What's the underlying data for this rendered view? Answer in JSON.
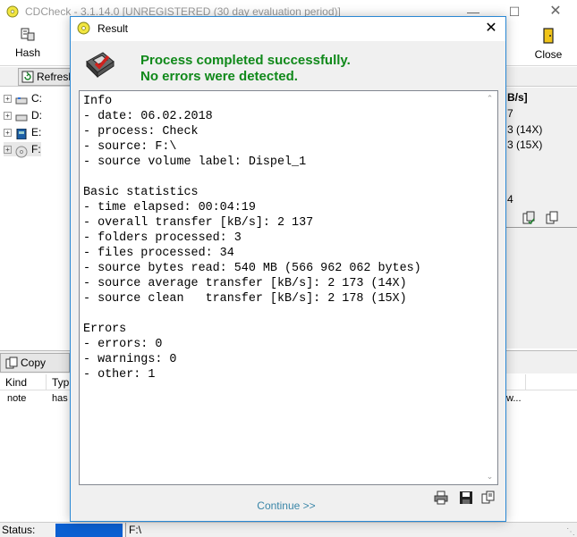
{
  "main": {
    "title": "CDCheck - 3.1.14.0 [UNREGISTERED (30 day evaluation period)]",
    "toolbar": {
      "hash_label": "Hash",
      "close_label": "Close"
    },
    "refresh_label": "Refresh",
    "drives": [
      {
        "label": "C:",
        "icon": "hard-drive-icon"
      },
      {
        "label": "D:",
        "icon": "hard-drive-icon"
      },
      {
        "label": "E:",
        "icon": "usb-drive-icon"
      },
      {
        "label": "F:",
        "icon": "cd-drive-icon"
      }
    ],
    "right_panel": {
      "header": "B/s]",
      "l1": "7",
      "l2": "3 (14X)",
      "l3": "3 (15X)",
      "l4": "4"
    },
    "copy_label": "Copy",
    "list": {
      "columns": [
        "Kind",
        "Typ"
      ],
      "rows": [
        {
          "kind": "note",
          "type": "has",
          "tail": "w..."
        }
      ]
    },
    "status": {
      "label": "Status:",
      "path": "F:\\",
      "progress": 1.0,
      "progress_color": "#0a5fd1"
    }
  },
  "dialog": {
    "title": "Result",
    "message_line1": "Process completed successfully.",
    "message_line2": "No errors were detected.",
    "message_color": "#10891a",
    "report_lines": [
      "Info",
      "- date: 06.02.2018",
      "- process: Check",
      "- source: F:\\",
      "- source volume label: Dispel_1",
      "",
      "Basic statistics",
      "- time elapsed: 00:04:19",
      "- overall transfer [kB/s]: 2 137",
      "- folders processed: 3",
      "- files processed: 34",
      "- source bytes read: 540 MB (566 962 062 bytes)",
      "- source average transfer [kB/s]: 2 173 (14X)",
      "- source clean   transfer [kB/s]: 2 178 (15X)",
      "",
      "Errors",
      "- errors: 0",
      "- warnings: 0",
      "- other: 1"
    ],
    "continue_label": "Continue >>"
  }
}
